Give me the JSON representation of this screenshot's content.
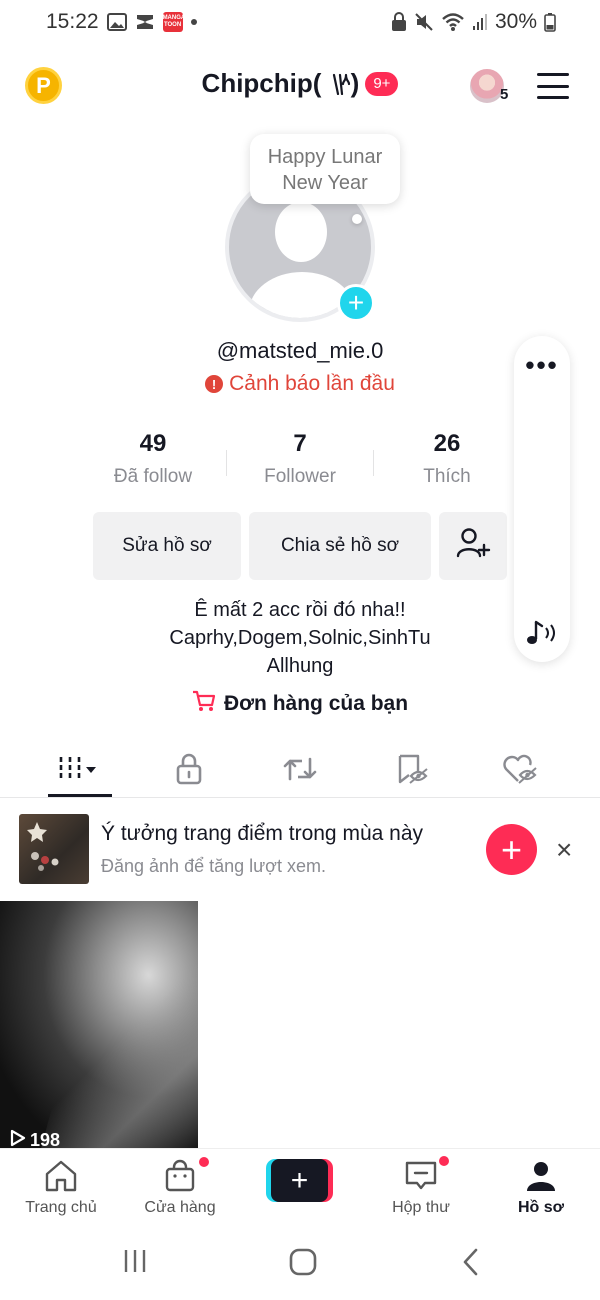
{
  "status_bar": {
    "time": "15:22",
    "manga_label": "MANGA TOON",
    "battery": "30%"
  },
  "header": {
    "coin_label": "P",
    "title": "Chipchip(🝋)",
    "notification_badge": "9+",
    "friend_count": "5"
  },
  "profile": {
    "bubble_text_line1": "Happy Lunar",
    "bubble_text_line2": "New Year",
    "username": "@matsted_mie.0",
    "warning_text": "Cảnh báo lần đầu",
    "stats": [
      {
        "value": "49",
        "label": "Đã follow"
      },
      {
        "value": "7",
        "label": "Follower"
      },
      {
        "value": "26",
        "label": "Thích"
      }
    ],
    "edit_button": "Sửa hồ sơ",
    "share_button": "Chia sẻ hồ sơ",
    "bio_line1": "Ê mất 2 acc rồi đó nha!!",
    "bio_line2": "Caprhy,Dogem,Solnic,SinhTu",
    "bio_line3": "Allhung",
    "orders_label": "Đơn hàng của bạn"
  },
  "side_panel": {
    "more_label": "•••"
  },
  "tabs": [
    "videos-grid",
    "private",
    "reposts",
    "favorites",
    "liked"
  ],
  "suggestion": {
    "title": "Ý tưởng trang điểm trong mùa này",
    "subtitle": "Đăng ảnh để tăng lượt xem.",
    "close_label": "×"
  },
  "videos": [
    {
      "views": "198"
    }
  ],
  "bottom_nav": {
    "home": "Trang chủ",
    "shop": "Cửa hàng",
    "inbox": "Hộp thư",
    "profile": "Hồ sơ"
  },
  "colors": {
    "accent_red": "#fe2c55",
    "accent_cyan": "#20d5ec",
    "warning": "#e0453a"
  }
}
